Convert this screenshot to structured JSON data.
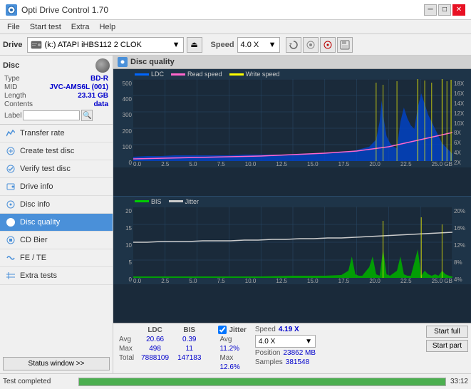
{
  "titlebar": {
    "title": "Opti Drive Control 1.70",
    "icon": "ODC",
    "minimize": "─",
    "maximize": "□",
    "close": "✕"
  },
  "menubar": {
    "items": [
      "File",
      "Start test",
      "Extra",
      "Help"
    ]
  },
  "drivebar": {
    "label": "Drive",
    "drive_text": "(k:)  ATAPI iHBS112  2 CLOK",
    "speed_label": "Speed",
    "speed_value": "4.0 X",
    "eject_icon": "⏏"
  },
  "disc": {
    "title": "Disc",
    "type_label": "Type",
    "type_val": "BD-R",
    "mid_label": "MID",
    "mid_val": "JVC-AMS6L (001)",
    "length_label": "Length",
    "length_val": "23.31 GB",
    "contents_label": "Contents",
    "contents_val": "data",
    "label_label": "Label"
  },
  "nav": {
    "items": [
      {
        "id": "transfer-rate",
        "label": "Transfer rate",
        "active": false
      },
      {
        "id": "create-test-disc",
        "label": "Create test disc",
        "active": false
      },
      {
        "id": "verify-test-disc",
        "label": "Verify test disc",
        "active": false
      },
      {
        "id": "drive-info",
        "label": "Drive info",
        "active": false
      },
      {
        "id": "disc-info",
        "label": "Disc info",
        "active": false
      },
      {
        "id": "disc-quality",
        "label": "Disc quality",
        "active": true
      },
      {
        "id": "cd-bier",
        "label": "CD Bier",
        "active": false
      },
      {
        "id": "fe-te",
        "label": "FE / TE",
        "active": false
      },
      {
        "id": "extra-tests",
        "label": "Extra tests",
        "active": false
      }
    ],
    "status_btn": "Status window >>"
  },
  "quality_panel": {
    "title": "Disc quality",
    "legend1": {
      "ldc_color": "#0066ff",
      "ldc_label": "LDC",
      "read_color": "#ff66cc",
      "read_label": "Read speed",
      "write_color": "#ffff00",
      "write_label": "Write speed"
    },
    "legend2": {
      "bis_color": "#00cc00",
      "bis_label": "BIS",
      "jitter_color": "#cccccc",
      "jitter_label": "Jitter"
    },
    "chart1": {
      "y_labels": [
        "500",
        "400",
        "300",
        "200",
        "100",
        "0"
      ],
      "y_right_labels": [
        "18X",
        "16X",
        "14X",
        "12X",
        "10X",
        "8X",
        "6X",
        "4X",
        "2X"
      ],
      "x_labels": [
        "0.0",
        "2.5",
        "5.0",
        "7.5",
        "10.0",
        "12.5",
        "15.0",
        "17.5",
        "20.0",
        "22.5",
        "25.0 GB"
      ]
    },
    "chart2": {
      "y_labels": [
        "20",
        "15",
        "10",
        "5",
        "0"
      ],
      "y_right_labels": [
        "20%",
        "16%",
        "12%",
        "8%",
        "4%"
      ],
      "x_labels": [
        "0.0",
        "2.5",
        "5.0",
        "7.5",
        "10.0",
        "12.5",
        "15.0",
        "17.5",
        "20.0",
        "22.5",
        "25.0 GB"
      ]
    }
  },
  "stats": {
    "col_headers": [
      "LDC",
      "BIS",
      "",
      "Jitter",
      "Speed",
      ""
    ],
    "avg_label": "Avg",
    "avg_ldc": "20.66",
    "avg_bis": "0.39",
    "avg_jitter": "11.2%",
    "max_label": "Max",
    "max_ldc": "498",
    "max_bis": "11",
    "max_jitter": "12.6%",
    "total_label": "Total",
    "total_ldc": "7888109",
    "total_bis": "147183",
    "jitter_checked": true,
    "jitter_label": "Jitter",
    "speed_current": "4.19 X",
    "speed_setting": "4.0 X",
    "position_label": "Position",
    "position_val": "23862 MB",
    "samples_label": "Samples",
    "samples_val": "381548",
    "start_full": "Start full",
    "start_part": "Start part"
  },
  "statusbar": {
    "text": "Test completed",
    "progress": 100,
    "time": "33:12"
  }
}
